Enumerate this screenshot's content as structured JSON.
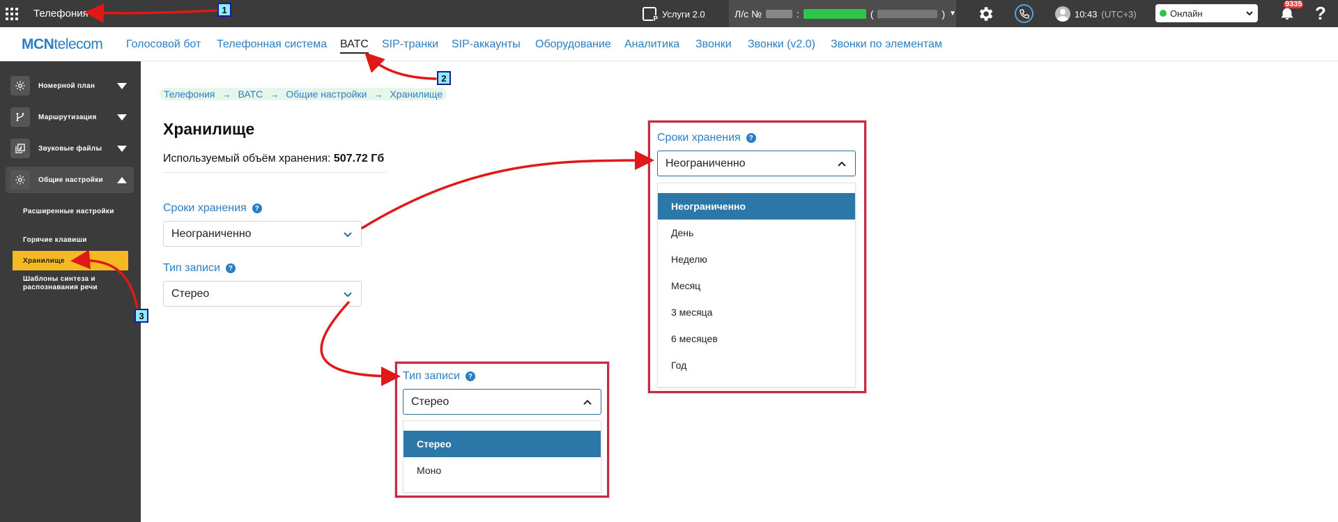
{
  "topbar": {
    "app_title": "Телефония",
    "services_label": "Услуги 2.0",
    "account_prefix": "Л/с №",
    "account_colon": ":",
    "account_paren_open": "(",
    "account_paren_close": ")",
    "time": "10:43",
    "timezone": "(UTC+3)",
    "status_value": "Онлайн",
    "notifications_count": "9335",
    "help_label": "?"
  },
  "logo": {
    "brand_bold": "MCN",
    "brand_rest": "telecom"
  },
  "nav": {
    "items": [
      {
        "label": "Голосовой бот"
      },
      {
        "label": "Телефонная система"
      },
      {
        "label": "ВАТС"
      },
      {
        "label": "SIP-транки"
      },
      {
        "label": "SIP-аккаунты"
      },
      {
        "label": "Оборудование"
      },
      {
        "label": "Аналитика"
      },
      {
        "label": "Звонки"
      },
      {
        "label": "Звонки (v2.0)"
      },
      {
        "label": "Звонки по элементам"
      }
    ]
  },
  "sidebar": {
    "items": [
      {
        "label": "Номерной план"
      },
      {
        "label": "Маршрутизация"
      },
      {
        "label": "Звуковые файлы"
      },
      {
        "label": "Общие настройки"
      }
    ],
    "subitems": [
      {
        "label": "Расширенные настройки"
      },
      {
        "label": "Горячие клавиши"
      },
      {
        "label": "Хранилище"
      },
      {
        "label": "Шаблоны синтеза и распознавания речи"
      }
    ]
  },
  "breadcrumb": {
    "items": [
      "Телефония",
      "ВАТС",
      "Общие настройки",
      "Хранилище"
    ],
    "separator": "→"
  },
  "page": {
    "title": "Хранилище",
    "usage_label": "Используемый объём хранения:",
    "usage_value": "507.72 Гб",
    "retention_label": "Сроки хранения",
    "retention_value": "Неограниченно",
    "record_type_label": "Тип записи",
    "record_type_value": "Стерео",
    "help_glyph": "?"
  },
  "retention_dropdown": {
    "label": "Сроки хранения",
    "value": "Неограниченно",
    "options": [
      "Неограниченно",
      "День",
      "Неделю",
      "Месяц",
      "3 месяца",
      "6 месяцев",
      "Год"
    ]
  },
  "record_dropdown": {
    "label": "Тип записи",
    "value": "Стерео",
    "options": [
      "Стерео",
      "Моно"
    ]
  },
  "markers": [
    "1",
    "2",
    "3"
  ],
  "colors": {
    "topbar": "#3b3b3b",
    "accent_blue": "#2b7ec2",
    "selected_option": "#2b77a8",
    "sidebar_active": "#f5b921",
    "callout_border": "#c62a44",
    "arrow_red": "#e01818",
    "online_green": "#2fc54a"
  }
}
